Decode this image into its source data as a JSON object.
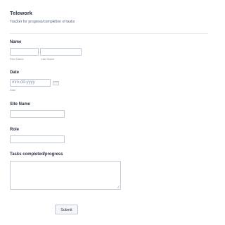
{
  "form": {
    "title": "Telework",
    "subtitle": "Tracker for progress/completion of tasks"
  },
  "name": {
    "label": "Name",
    "first_sublabel": "First Name",
    "last_sublabel": "Last Name"
  },
  "date": {
    "label": "Date",
    "placeholder": "mm-dd-yyyy",
    "sublabel": "Date",
    "icon": "calendar-icon"
  },
  "site": {
    "label": "Site Name"
  },
  "role": {
    "label": "Role"
  },
  "tasks": {
    "label": "Tasks completed/progress"
  },
  "submit": {
    "label": "Submit"
  }
}
